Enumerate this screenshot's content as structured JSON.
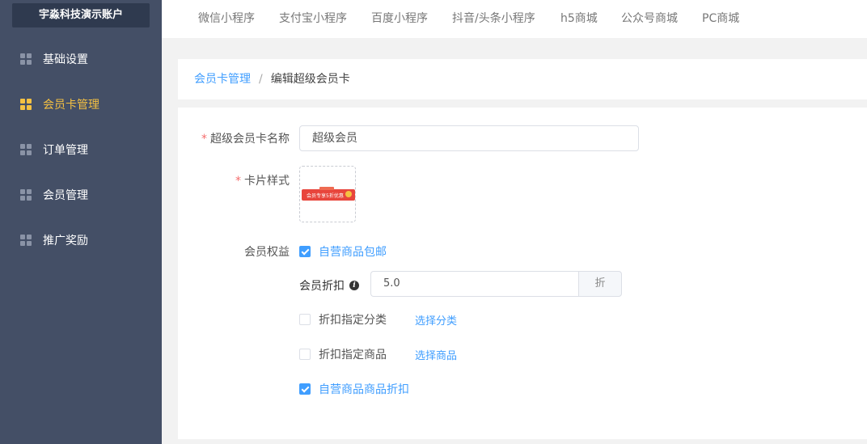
{
  "sidebar": {
    "account": "宇淼科技演示账户",
    "items": [
      {
        "label": "基础设置",
        "active": false
      },
      {
        "label": "会员卡管理",
        "active": true
      },
      {
        "label": "订单管理",
        "active": false
      },
      {
        "label": "会员管理",
        "active": false
      },
      {
        "label": "推广奖励",
        "active": false
      }
    ]
  },
  "topbar": {
    "tabs": [
      "微信小程序",
      "支付宝小程序",
      "百度小程序",
      "抖音/头条小程序",
      "h5商城",
      "公众号商城",
      "PC商城"
    ]
  },
  "breadcrumb": {
    "parent": "会员卡管理",
    "separator": "/",
    "current": "编辑超级会员卡"
  },
  "form": {
    "required_mark": "*",
    "name_label": "超级会员卡名称",
    "name_value": "超级会员",
    "card_style_label": "卡片样式",
    "card_thumb_text": "会员专享5折优惠",
    "benefits_label": "会员权益",
    "free_shipping": {
      "label": "自营商品包邮",
      "checked": true
    },
    "discount": {
      "label": "会员折扣",
      "info_icon": "i",
      "value": "5.0",
      "unit": "折"
    },
    "discount_category": {
      "label": "折扣指定分类",
      "checked": false,
      "link": "选择分类"
    },
    "discount_goods": {
      "label": "折扣指定商品",
      "checked": false,
      "link": "选择商品"
    },
    "self_goods_discount": {
      "label": "自营商品商品折扣",
      "checked": true
    }
  },
  "colors": {
    "sidebar_bg": "#444f66",
    "active": "#f5c142",
    "primary": "#409eff",
    "required": "#f56c6c"
  }
}
